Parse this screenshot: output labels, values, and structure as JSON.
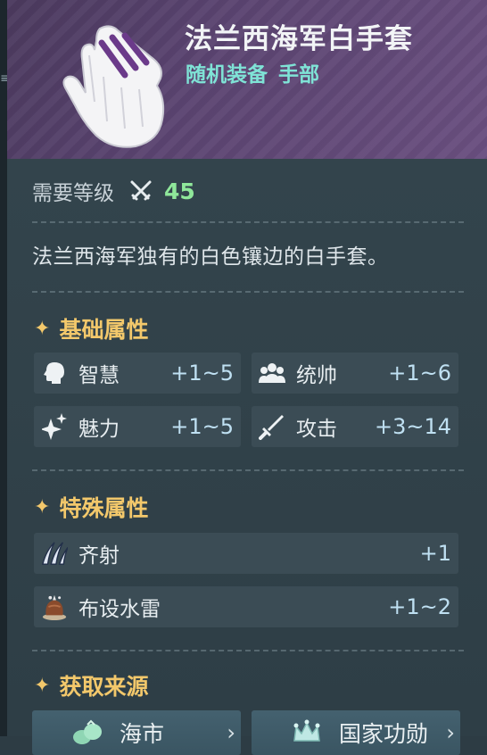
{
  "item": {
    "name": "法兰西海军白手套",
    "type_line": "随机装备 手部"
  },
  "requirement": {
    "label": "需要等级",
    "value": "45",
    "icon": "crossed-swords-icon"
  },
  "description": "法兰西海军独有的白色镶边的白手套。",
  "sections": {
    "base_stats_title": "基础属性",
    "special_stats_title": "特殊属性",
    "sources_title": "获取来源",
    "star_glyph": "✦"
  },
  "base_stats": [
    {
      "name": "智慧",
      "value": "+1~5",
      "icon": "head-silhouette-icon"
    },
    {
      "name": "统帅",
      "value": "+1~6",
      "icon": "group-people-icon"
    },
    {
      "name": "魅力",
      "value": "+1~5",
      "icon": "sparkles-icon"
    },
    {
      "name": "攻击",
      "value": "+3~14",
      "icon": "sword-icon"
    }
  ],
  "special_stats": [
    {
      "name": "齐射",
      "value": "+1",
      "icon": "volley-claw-icon"
    },
    {
      "name": "布设水雷",
      "value": "+1~2",
      "icon": "sea-mine-icon"
    }
  ],
  "sources": [
    {
      "label": "海市",
      "icon": "market-icon"
    },
    {
      "label": "国家功勋",
      "icon": "crown-icon"
    }
  ],
  "colors": {
    "header_bg": "#5b4471",
    "body_bg": "#2e3e46",
    "accent_teal": "#7fe3d6",
    "accent_green": "#8fe79a",
    "accent_gold": "#f3c86b",
    "stat_value": "#bfe0f2"
  }
}
